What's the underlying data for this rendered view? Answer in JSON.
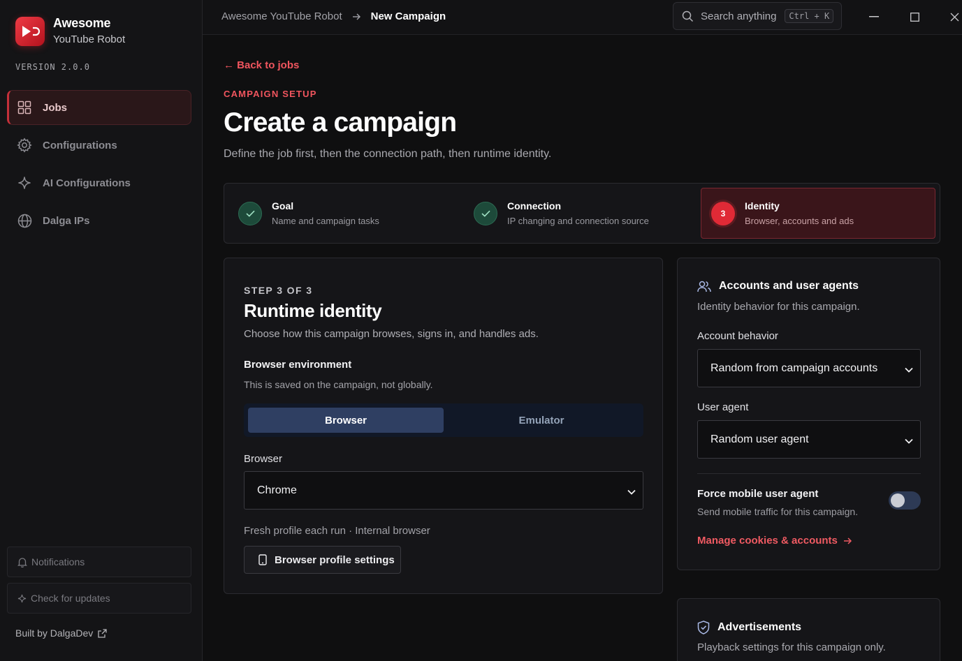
{
  "app": {
    "title": "Awesome",
    "subtitle": "YouTube Robot",
    "version": "VERSION 2.0.0"
  },
  "sidebar": {
    "items": [
      {
        "label": "Jobs",
        "icon": "grid-icon",
        "active": true
      },
      {
        "label": "Configurations",
        "icon": "gear-icon",
        "active": false
      },
      {
        "label": "AI Configurations",
        "icon": "sparkle-icon",
        "active": false
      },
      {
        "label": "Dalga IPs",
        "icon": "globe-icon",
        "active": false
      }
    ],
    "notifications": "Notifications",
    "check_updates": "Check for updates",
    "built_by": "Built by DalgaDev"
  },
  "topbar": {
    "crumb_root": "Awesome YouTube Robot",
    "crumb_current": "New Campaign",
    "search_placeholder": "Search anything",
    "search_shortcut": "Ctrl + K"
  },
  "page": {
    "back": "← Back to jobs",
    "eyebrow": "CAMPAIGN SETUP",
    "title": "Create a campaign",
    "description": "Define the job first, then the connection path, then runtime identity."
  },
  "steps": [
    {
      "title": "Goal",
      "subtitle": "Name and campaign tasks",
      "status": "done"
    },
    {
      "title": "Connection",
      "subtitle": "IP changing and connection source",
      "status": "done"
    },
    {
      "number": "3",
      "title": "Identity",
      "subtitle": "Browser, accounts and ads",
      "status": "current"
    }
  ],
  "identity": {
    "eyebrow": "STEP 3 OF 3",
    "title": "Runtime identity",
    "description": "Choose how this campaign browses, signs in, and handles ads.",
    "env_title": "Browser environment",
    "env_desc": "This is saved on the campaign, not globally.",
    "env_options": [
      "Browser",
      "Emulator"
    ],
    "env_selected": "Browser",
    "browser_label": "Browser",
    "browser_value": "Chrome",
    "hint": "Fresh profile each run · Internal browser",
    "profile_button": "Browser profile settings"
  },
  "accounts": {
    "title": "Accounts and user agents",
    "description": "Identity behavior for this campaign.",
    "account_behavior_label": "Account behavior",
    "account_behavior_value": "Random from campaign accounts",
    "user_agent_label": "User agent",
    "user_agent_value": "Random user agent",
    "force_mobile_title": "Force mobile user agent",
    "force_mobile_desc": "Send mobile traffic for this campaign.",
    "force_mobile_on": false,
    "manage_link": "Manage cookies & accounts"
  },
  "ads": {
    "title": "Advertisements",
    "description": "Playback settings for this campaign only."
  },
  "colors": {
    "accent": "#e02a36",
    "link": "#f0555e",
    "success": "#2c6b53",
    "segment_active": "#2f3f62"
  }
}
